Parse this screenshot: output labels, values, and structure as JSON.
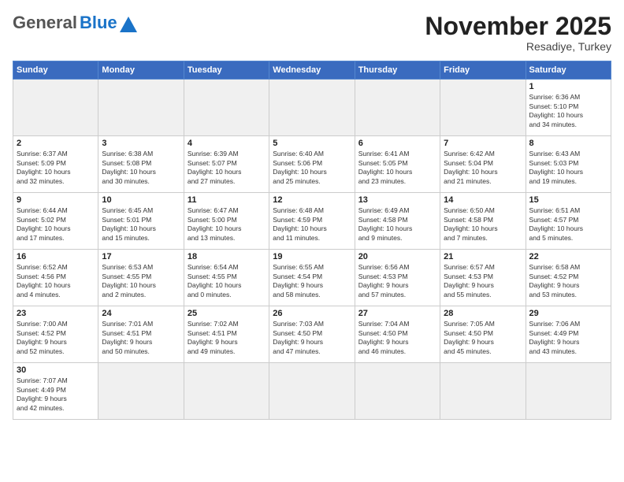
{
  "header": {
    "title": "November 2025",
    "subtitle": "Resadiye, Turkey",
    "logo_general": "General",
    "logo_blue": "Blue"
  },
  "weekdays": [
    "Sunday",
    "Monday",
    "Tuesday",
    "Wednesday",
    "Thursday",
    "Friday",
    "Saturday"
  ],
  "weeks": [
    [
      {
        "day": "",
        "info": ""
      },
      {
        "day": "",
        "info": ""
      },
      {
        "day": "",
        "info": ""
      },
      {
        "day": "",
        "info": ""
      },
      {
        "day": "",
        "info": ""
      },
      {
        "day": "",
        "info": ""
      },
      {
        "day": "1",
        "info": "Sunrise: 6:36 AM\nSunset: 5:10 PM\nDaylight: 10 hours\nand 34 minutes."
      }
    ],
    [
      {
        "day": "2",
        "info": "Sunrise: 6:37 AM\nSunset: 5:09 PM\nDaylight: 10 hours\nand 32 minutes."
      },
      {
        "day": "3",
        "info": "Sunrise: 6:38 AM\nSunset: 5:08 PM\nDaylight: 10 hours\nand 30 minutes."
      },
      {
        "day": "4",
        "info": "Sunrise: 6:39 AM\nSunset: 5:07 PM\nDaylight: 10 hours\nand 27 minutes."
      },
      {
        "day": "5",
        "info": "Sunrise: 6:40 AM\nSunset: 5:06 PM\nDaylight: 10 hours\nand 25 minutes."
      },
      {
        "day": "6",
        "info": "Sunrise: 6:41 AM\nSunset: 5:05 PM\nDaylight: 10 hours\nand 23 minutes."
      },
      {
        "day": "7",
        "info": "Sunrise: 6:42 AM\nSunset: 5:04 PM\nDaylight: 10 hours\nand 21 minutes."
      },
      {
        "day": "8",
        "info": "Sunrise: 6:43 AM\nSunset: 5:03 PM\nDaylight: 10 hours\nand 19 minutes."
      }
    ],
    [
      {
        "day": "9",
        "info": "Sunrise: 6:44 AM\nSunset: 5:02 PM\nDaylight: 10 hours\nand 17 minutes."
      },
      {
        "day": "10",
        "info": "Sunrise: 6:45 AM\nSunset: 5:01 PM\nDaylight: 10 hours\nand 15 minutes."
      },
      {
        "day": "11",
        "info": "Sunrise: 6:47 AM\nSunset: 5:00 PM\nDaylight: 10 hours\nand 13 minutes."
      },
      {
        "day": "12",
        "info": "Sunrise: 6:48 AM\nSunset: 4:59 PM\nDaylight: 10 hours\nand 11 minutes."
      },
      {
        "day": "13",
        "info": "Sunrise: 6:49 AM\nSunset: 4:58 PM\nDaylight: 10 hours\nand 9 minutes."
      },
      {
        "day": "14",
        "info": "Sunrise: 6:50 AM\nSunset: 4:58 PM\nDaylight: 10 hours\nand 7 minutes."
      },
      {
        "day": "15",
        "info": "Sunrise: 6:51 AM\nSunset: 4:57 PM\nDaylight: 10 hours\nand 5 minutes."
      }
    ],
    [
      {
        "day": "16",
        "info": "Sunrise: 6:52 AM\nSunset: 4:56 PM\nDaylight: 10 hours\nand 4 minutes."
      },
      {
        "day": "17",
        "info": "Sunrise: 6:53 AM\nSunset: 4:55 PM\nDaylight: 10 hours\nand 2 minutes."
      },
      {
        "day": "18",
        "info": "Sunrise: 6:54 AM\nSunset: 4:55 PM\nDaylight: 10 hours\nand 0 minutes."
      },
      {
        "day": "19",
        "info": "Sunrise: 6:55 AM\nSunset: 4:54 PM\nDaylight: 9 hours\nand 58 minutes."
      },
      {
        "day": "20",
        "info": "Sunrise: 6:56 AM\nSunset: 4:53 PM\nDaylight: 9 hours\nand 57 minutes."
      },
      {
        "day": "21",
        "info": "Sunrise: 6:57 AM\nSunset: 4:53 PM\nDaylight: 9 hours\nand 55 minutes."
      },
      {
        "day": "22",
        "info": "Sunrise: 6:58 AM\nSunset: 4:52 PM\nDaylight: 9 hours\nand 53 minutes."
      }
    ],
    [
      {
        "day": "23",
        "info": "Sunrise: 7:00 AM\nSunset: 4:52 PM\nDaylight: 9 hours\nand 52 minutes."
      },
      {
        "day": "24",
        "info": "Sunrise: 7:01 AM\nSunset: 4:51 PM\nDaylight: 9 hours\nand 50 minutes."
      },
      {
        "day": "25",
        "info": "Sunrise: 7:02 AM\nSunset: 4:51 PM\nDaylight: 9 hours\nand 49 minutes."
      },
      {
        "day": "26",
        "info": "Sunrise: 7:03 AM\nSunset: 4:50 PM\nDaylight: 9 hours\nand 47 minutes."
      },
      {
        "day": "27",
        "info": "Sunrise: 7:04 AM\nSunset: 4:50 PM\nDaylight: 9 hours\nand 46 minutes."
      },
      {
        "day": "28",
        "info": "Sunrise: 7:05 AM\nSunset: 4:50 PM\nDaylight: 9 hours\nand 45 minutes."
      },
      {
        "day": "29",
        "info": "Sunrise: 7:06 AM\nSunset: 4:49 PM\nDaylight: 9 hours\nand 43 minutes."
      }
    ],
    [
      {
        "day": "30",
        "info": "Sunrise: 7:07 AM\nSunset: 4:49 PM\nDaylight: 9 hours\nand 42 minutes."
      },
      {
        "day": "",
        "info": ""
      },
      {
        "day": "",
        "info": ""
      },
      {
        "day": "",
        "info": ""
      },
      {
        "day": "",
        "info": ""
      },
      {
        "day": "",
        "info": ""
      },
      {
        "day": "",
        "info": ""
      }
    ]
  ]
}
